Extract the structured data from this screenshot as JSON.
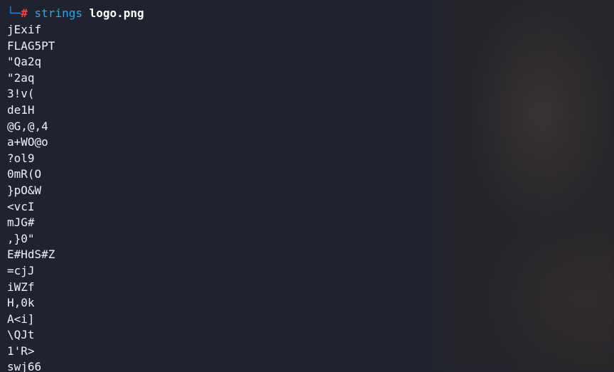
{
  "terminal": {
    "prompt": {
      "corner_glyph": "└─",
      "hash_glyph": "#",
      "command": "strings",
      "argument": "logo.png"
    },
    "output_lines": [
      "jExif",
      "FLAG5PT",
      "\"Qa2q",
      "\"2aq",
      "3!v(",
      "de1H",
      "@G,@,4",
      "a+WO@o",
      "?ol9",
      "0mR(O",
      "}pO&W",
      "<vcI",
      "mJG#",
      ",}0\"",
      "E#HdS#Z",
      "=cjJ",
      "iWZf",
      "H,0k",
      "A<i]",
      "\\QJt",
      "1'R>",
      "swj66"
    ]
  },
  "colors": {
    "background": "#1f2330",
    "prompt_corner": "#2f86d6",
    "prompt_hash": "#ff3b3b",
    "command": "#2aa7e6",
    "argument": "#ffffff",
    "output_text": "#eef0f5"
  }
}
